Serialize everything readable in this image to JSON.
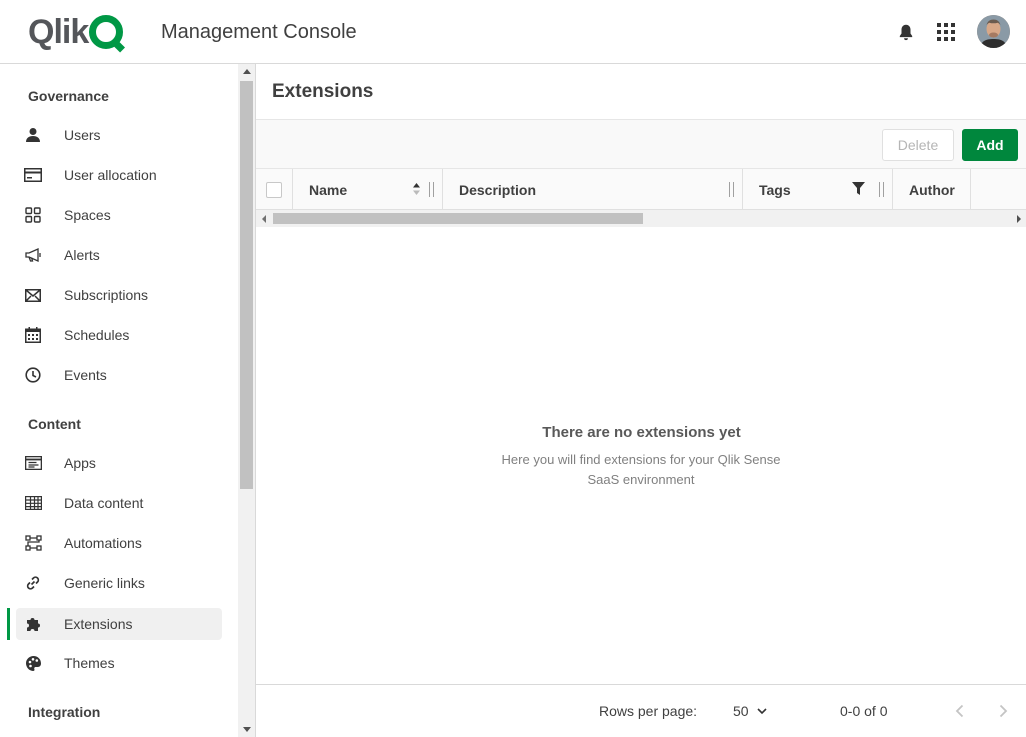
{
  "header": {
    "logo_text": "Qlik",
    "title": "Management Console",
    "icons": [
      "bell-icon",
      "apps-grid-icon"
    ],
    "avatar": "user-avatar"
  },
  "sidebar": {
    "sections": [
      {
        "title": "Governance",
        "items": [
          {
            "label": "Users",
            "icon": "user-icon"
          },
          {
            "label": "User allocation",
            "icon": "credit-card-icon"
          },
          {
            "label": "Spaces",
            "icon": "spaces-icon"
          },
          {
            "label": "Alerts",
            "icon": "megaphone-icon"
          },
          {
            "label": "Subscriptions",
            "icon": "envelope-icon"
          },
          {
            "label": "Schedules",
            "icon": "calendar-icon"
          },
          {
            "label": "Events",
            "icon": "clock-icon"
          }
        ]
      },
      {
        "title": "Content",
        "items": [
          {
            "label": "Apps",
            "icon": "app-icon"
          },
          {
            "label": "Data content",
            "icon": "table-icon"
          },
          {
            "label": "Automations",
            "icon": "automation-icon"
          },
          {
            "label": "Generic links",
            "icon": "link-icon"
          },
          {
            "label": "Extensions",
            "icon": "puzzle-icon",
            "active": true
          },
          {
            "label": "Themes",
            "icon": "palette-icon"
          }
        ]
      },
      {
        "title": "Integration",
        "items": []
      }
    ]
  },
  "main": {
    "page_title": "Extensions",
    "toolbar": {
      "delete_label": "Delete",
      "add_label": "Add"
    },
    "table": {
      "columns": [
        "Name",
        "Description",
        "Tags",
        "Author"
      ]
    },
    "empty": {
      "title": "There are no extensions yet",
      "text": "Here you will find extensions for your Qlik Sense SaaS environment"
    },
    "footer": {
      "rows_per_page_label": "Rows per page:",
      "rows_per_page_value": "50",
      "range": "0-0 of 0"
    }
  },
  "colors": {
    "accent": "#009845",
    "primary_button": "#00873d"
  }
}
